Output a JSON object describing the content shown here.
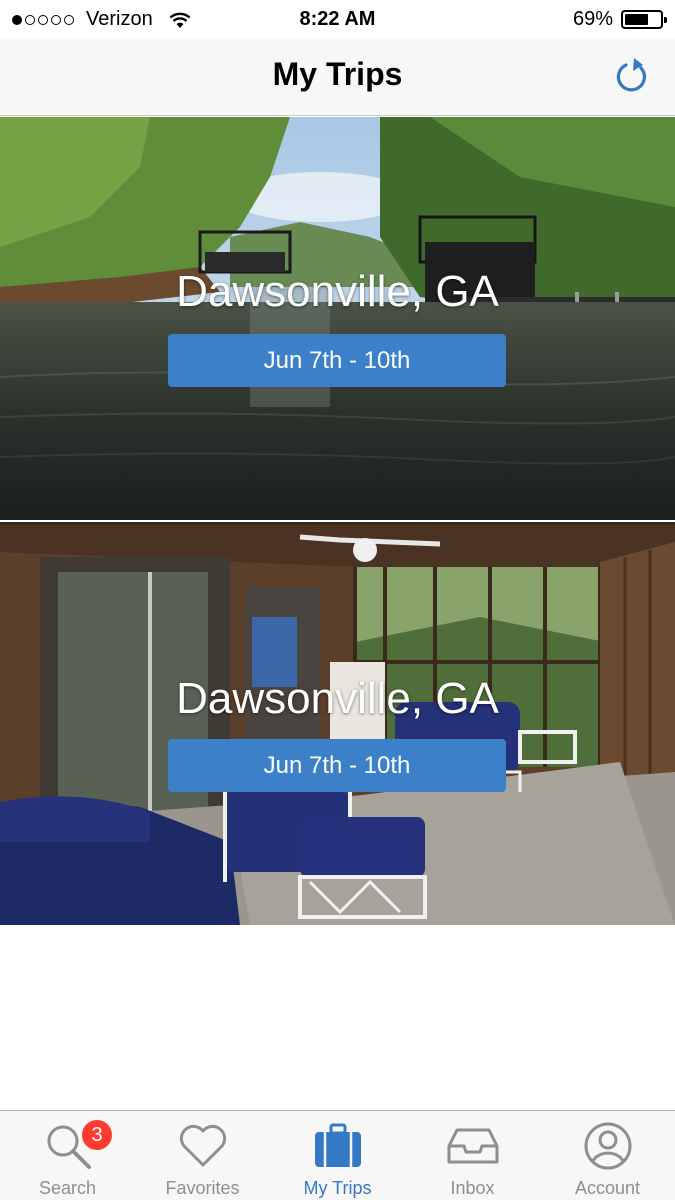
{
  "status_bar": {
    "carrier": "Verizon",
    "time": "8:22 AM",
    "battery": "69%",
    "battery_level": 0.69,
    "signal_bars_filled": 1,
    "signal_bars_total": 5
  },
  "nav": {
    "title": "My Trips",
    "refresh_icon": "refresh-icon"
  },
  "trips": [
    {
      "location": "Dawsonville, GA",
      "dates": "Jun 7th - 10th",
      "image": "lake-with-boat-docks"
    },
    {
      "location": "Dawsonville, GA",
      "dates": "Jun 7th - 10th",
      "image": "screened-porch-with-wicker-furniture"
    }
  ],
  "tabs": [
    {
      "label": "Search",
      "icon": "search-icon",
      "badge": "3",
      "active": false
    },
    {
      "label": "Favorites",
      "icon": "heart-icon",
      "active": false
    },
    {
      "label": "My Trips",
      "icon": "suitcase-icon",
      "active": true
    },
    {
      "label": "Inbox",
      "icon": "inbox-icon",
      "active": false
    },
    {
      "label": "Account",
      "icon": "person-icon",
      "active": false
    }
  ],
  "colors": {
    "accent": "#3478c6",
    "date_button": "#3b80c8",
    "badge": "#ff3b30",
    "inactive_tab": "#8e8e93"
  }
}
